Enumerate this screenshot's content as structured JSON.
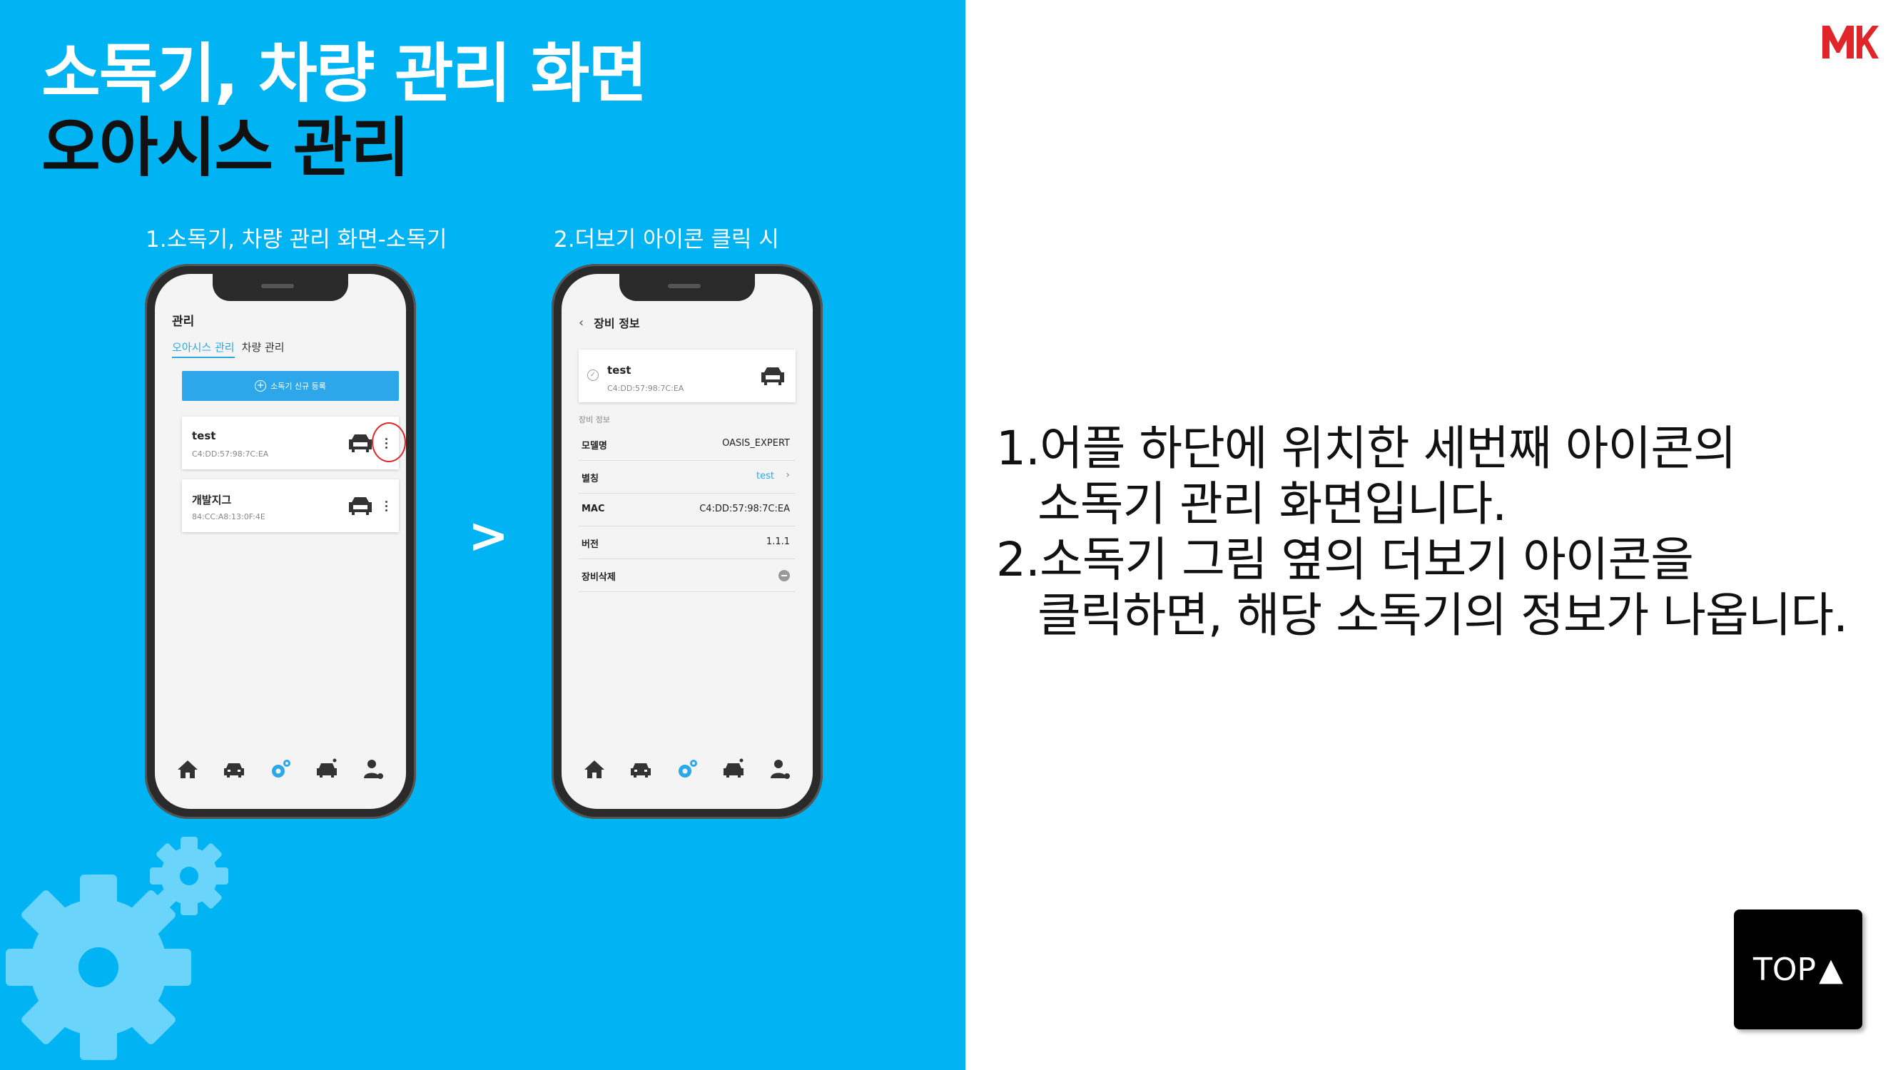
{
  "slide": {
    "title": "소독기, 차량 관리 화면",
    "subtitle": "오아시스 관리",
    "caption1": "1.소독기, 차량 관리 화면-소독기",
    "caption2": "2.더보기 아이콘 클릭 시",
    "arrow": ">",
    "logo_text": "MK",
    "description": [
      "1.어플 하단에 위치한 세번째 아이콘의",
      "소독기 관리 화면입니다.",
      "2.소독기 그림 옆의 더보기 아이콘을",
      "클릭하면, 해당 소독기의 정보가 나옵니다."
    ],
    "top_button": "TOP",
    "top_arrow": "▲"
  },
  "screen1": {
    "header": "관리",
    "tabs": [
      "오아시스 관리",
      "차량 관리"
    ],
    "register_button": "소독기 신규 등록",
    "devices": [
      {
        "name": "test",
        "mac": "C4:DD:57:98:7C:EA"
      },
      {
        "name": "개발지그",
        "mac": "84:CC:A8:13:0F:4E"
      }
    ]
  },
  "screen2": {
    "header": "장비 정보",
    "device": {
      "name": "test",
      "mac": "C4:DD:57:98:7C:EA"
    },
    "section_label": "장비 정보",
    "rows": [
      {
        "key": "모델명",
        "value": "OASIS_EXPERT"
      },
      {
        "key": "별칭",
        "value": "test"
      },
      {
        "key": "MAC",
        "value": "C4:DD:57:98:7C:EA"
      },
      {
        "key": "버전",
        "value": "1.1.1"
      },
      {
        "key": "장비삭제",
        "value": ""
      }
    ]
  },
  "nav_icons": [
    "home-icon",
    "car-icon",
    "gear-icon",
    "car-wash-icon",
    "user-icon"
  ],
  "colors": {
    "panel": "#00b3f2",
    "accent": "#2aa8e8",
    "highlight": "#e0262b",
    "logo": "#e0262b"
  }
}
